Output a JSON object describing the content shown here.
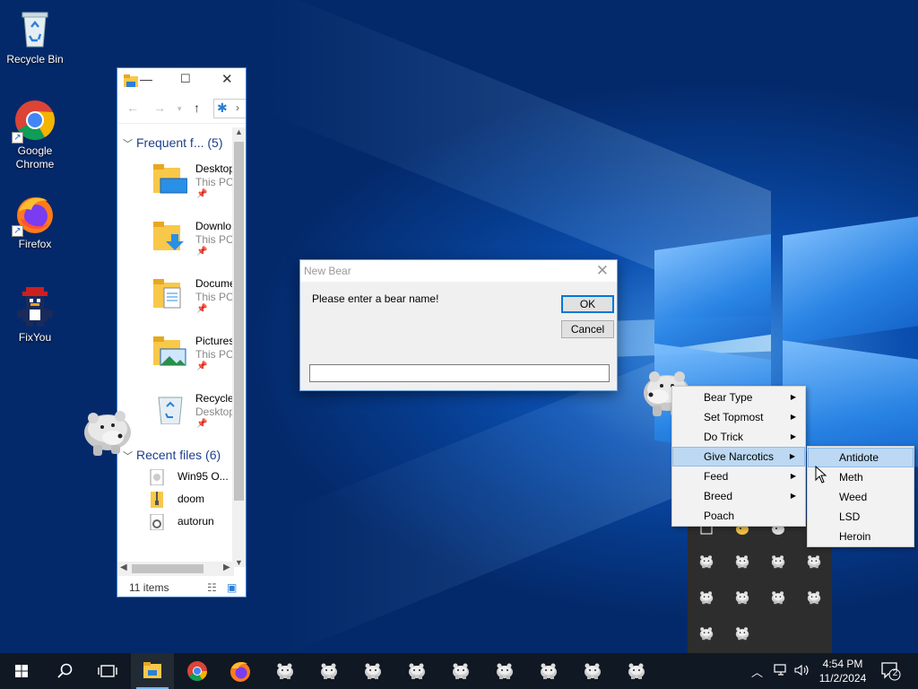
{
  "desktop": {
    "icons": [
      {
        "label": "Recycle Bin",
        "icon": "recycle-bin-icon"
      },
      {
        "label": "Google\nChrome",
        "icon": "chrome-icon"
      },
      {
        "label": "Firefox",
        "icon": "firefox-icon"
      },
      {
        "label": "FixYou",
        "icon": "fixyou-icon"
      }
    ]
  },
  "explorer": {
    "title_button_min": "—",
    "title_button_max": "☐",
    "title_button_close": "✕",
    "frequent_header": "Frequent f... (5)",
    "frequent": [
      {
        "name": "Desktop",
        "location": "This PC"
      },
      {
        "name": "Downlo",
        "location": "This PC"
      },
      {
        "name": "Docume",
        "location": "This PC"
      },
      {
        "name": "Pictures",
        "location": "This PC"
      },
      {
        "name": "Recycle",
        "location": "Desktop"
      }
    ],
    "recent_header": "Recent files (6)",
    "recent": [
      {
        "name": "Win95 O..."
      },
      {
        "name": "doom"
      },
      {
        "name": "autorun"
      }
    ],
    "status": "11 items"
  },
  "dialog": {
    "title": "New Bear",
    "prompt": "Please enter a bear name!",
    "ok_label": "OK",
    "cancel_label": "Cancel",
    "input_value": ""
  },
  "context_menu": {
    "items": [
      {
        "label": "Bear Type",
        "submenu": true
      },
      {
        "label": "Set Topmost",
        "submenu": true
      },
      {
        "label": "Do Trick",
        "submenu": true
      },
      {
        "label": "Give Narcotics",
        "submenu": true,
        "highlighted": true
      },
      {
        "label": "Feed",
        "submenu": true
      },
      {
        "label": "Breed",
        "submenu": true
      },
      {
        "label": "Poach",
        "submenu": false
      }
    ],
    "submenu": [
      {
        "label": "Antidote",
        "highlighted": true
      },
      {
        "label": "Meth"
      },
      {
        "label": "Weed"
      },
      {
        "label": "LSD"
      },
      {
        "label": "Heroin"
      }
    ]
  },
  "taskbar": {
    "apps": [
      "start-icon",
      "search-icon",
      "task-view-icon",
      "file-explorer-icon",
      "chrome-icon",
      "firefox-icon",
      "bear-app-icon",
      "bear-app-icon",
      "bear-app-icon",
      "bear-app-icon",
      "bear-app-icon",
      "bear-app-icon",
      "bear-app-icon",
      "bear-app-icon",
      "bear-app-icon"
    ],
    "time": "4:54 PM",
    "date": "11/2/2024",
    "notification_count": "2"
  },
  "colors": {
    "accent": "#0078d7",
    "menu_highlight": "#bcd8f2",
    "taskbar": "#101823"
  }
}
